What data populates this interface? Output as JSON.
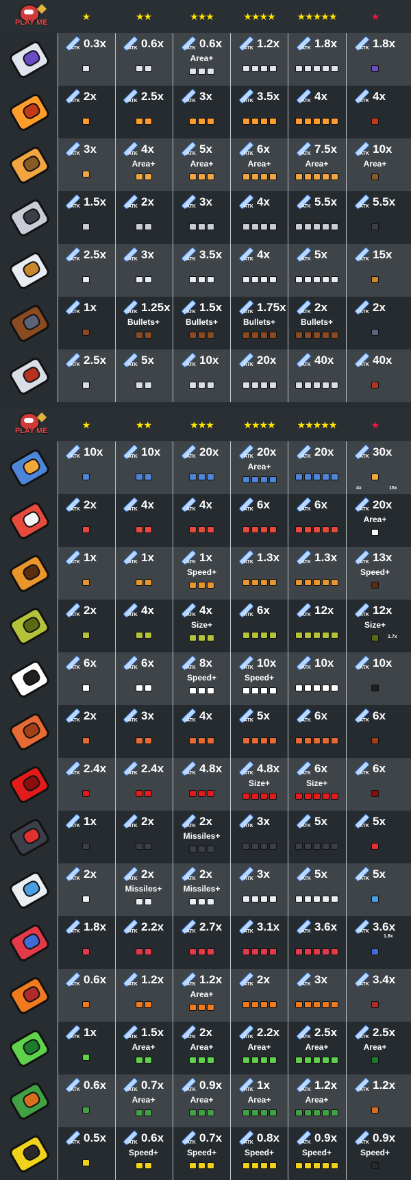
{
  "logo_text": "PLAY ME",
  "star_headers": [
    {
      "label": "★",
      "color": "yellow"
    },
    {
      "label": "★★",
      "color": "yellow"
    },
    {
      "label": "★★★",
      "color": "yellow"
    },
    {
      "label": "★★★★",
      "color": "yellow"
    },
    {
      "label": "★★★★★",
      "color": "yellow"
    },
    {
      "label": "★",
      "color": "red"
    }
  ],
  "atk_label": "ATK",
  "tables": [
    {
      "weapons": [
        {
          "icon": "blaster-gun-icon",
          "tiers": [
            {
              "m": "0.3x",
              "s": ""
            },
            {
              "m": "0.6x",
              "s": ""
            },
            {
              "m": "0.6x",
              "s": "Area+"
            },
            {
              "m": "1.2x",
              "s": ""
            },
            {
              "m": "1.8x",
              "s": ""
            },
            {
              "m": "1.8x",
              "s": ""
            }
          ]
        },
        {
          "icon": "flame-sword-icon",
          "tiers": [
            {
              "m": "2x",
              "s": ""
            },
            {
              "m": "2.5x",
              "s": ""
            },
            {
              "m": "3x",
              "s": ""
            },
            {
              "m": "3.5x",
              "s": ""
            },
            {
              "m": "4x",
              "s": ""
            },
            {
              "m": "4x",
              "s": ""
            }
          ]
        },
        {
          "icon": "guandao-spear-icon",
          "tiers": [
            {
              "m": "3x",
              "s": ""
            },
            {
              "m": "4x",
              "s": "Area+"
            },
            {
              "m": "5x",
              "s": "Area+"
            },
            {
              "m": "6x",
              "s": "Area+"
            },
            {
              "m": "7.5x",
              "s": "Area+"
            },
            {
              "m": "10x",
              "s": "Area+"
            }
          ]
        },
        {
          "icon": "kunai-icon",
          "tiers": [
            {
              "m": "1.5x",
              "s": ""
            },
            {
              "m": "2x",
              "s": ""
            },
            {
              "m": "3x",
              "s": ""
            },
            {
              "m": "4x",
              "s": ""
            },
            {
              "m": "5.5x",
              "s": ""
            },
            {
              "m": "5.5x",
              "s": ""
            }
          ]
        },
        {
          "icon": "katana-icon",
          "tiers": [
            {
              "m": "2.5x",
              "s": ""
            },
            {
              "m": "3x",
              "s": ""
            },
            {
              "m": "3.5x",
              "s": ""
            },
            {
              "m": "4x",
              "s": ""
            },
            {
              "m": "5x",
              "s": ""
            },
            {
              "m": "15x",
              "s": ""
            }
          ]
        },
        {
          "icon": "shotgun-icon",
          "tiers": [
            {
              "m": "1x",
              "s": ""
            },
            {
              "m": "1.25x",
              "s": "Bullets+"
            },
            {
              "m": "1.5x",
              "s": "Bullets+"
            },
            {
              "m": "1.75x",
              "s": "Bullets+"
            },
            {
              "m": "2x",
              "s": "Bullets+"
            },
            {
              "m": "2x",
              "s": ""
            }
          ]
        },
        {
          "icon": "revolver-icon",
          "tiers": [
            {
              "m": "2.5x",
              "s": ""
            },
            {
              "m": "5x",
              "s": ""
            },
            {
              "m": "10x",
              "s": ""
            },
            {
              "m": "20x",
              "s": ""
            },
            {
              "m": "40x",
              "s": ""
            },
            {
              "m": "40x",
              "s": ""
            }
          ]
        }
      ]
    },
    {
      "weapons": [
        {
          "icon": "drone-disc-icon",
          "tiers": [
            {
              "m": "10x",
              "s": ""
            },
            {
              "m": "10x",
              "s": ""
            },
            {
              "m": "20x",
              "s": ""
            },
            {
              "m": "20x",
              "s": "Area+"
            },
            {
              "m": "20x",
              "s": ""
            },
            {
              "m": "30x",
              "s": ""
            }
          ]
        },
        {
          "icon": "rocket-icon",
          "tiers": [
            {
              "m": "2x",
              "s": ""
            },
            {
              "m": "4x",
              "s": ""
            },
            {
              "m": "4x",
              "s": ""
            },
            {
              "m": "6x",
              "s": ""
            },
            {
              "m": "6x",
              "s": ""
            },
            {
              "m": "20x",
              "s": "Area+"
            }
          ]
        },
        {
          "icon": "drill-cone-icon",
          "tiers": [
            {
              "m": "1x",
              "s": ""
            },
            {
              "m": "1x",
              "s": ""
            },
            {
              "m": "1x",
              "s": "Speed+"
            },
            {
              "m": "1.3x",
              "s": ""
            },
            {
              "m": "1.3x",
              "s": ""
            },
            {
              "m": "13x",
              "s": "Speed+"
            }
          ]
        },
        {
          "icon": "durian-icon",
          "tiers": [
            {
              "m": "2x",
              "s": ""
            },
            {
              "m": "4x",
              "s": ""
            },
            {
              "m": "4x",
              "s": "Size+"
            },
            {
              "m": "6x",
              "s": ""
            },
            {
              "m": "12x",
              "s": ""
            },
            {
              "m": "12x",
              "s": "Size+"
            }
          ]
        },
        {
          "icon": "soccer-ball-icon",
          "tiers": [
            {
              "m": "6x",
              "s": ""
            },
            {
              "m": "6x",
              "s": ""
            },
            {
              "m": "8x",
              "s": "Speed+"
            },
            {
              "m": "10x",
              "s": "Speed+"
            },
            {
              "m": "10x",
              "s": ""
            },
            {
              "m": "10x",
              "s": ""
            }
          ]
        },
        {
          "icon": "brick-icon",
          "tiers": [
            {
              "m": "2x",
              "s": ""
            },
            {
              "m": "3x",
              "s": ""
            },
            {
              "m": "4x",
              "s": ""
            },
            {
              "m": "5x",
              "s": ""
            },
            {
              "m": "6x",
              "s": ""
            },
            {
              "m": "6x",
              "s": ""
            }
          ]
        },
        {
          "icon": "boomerang-icon",
          "tiers": [
            {
              "m": "2.4x",
              "s": ""
            },
            {
              "m": "2.4x",
              "s": ""
            },
            {
              "m": "4.8x",
              "s": ""
            },
            {
              "m": "4.8x",
              "s": "Size+"
            },
            {
              "m": "6x",
              "s": "Size+"
            },
            {
              "m": "6x",
              "s": ""
            }
          ]
        },
        {
          "icon": "missile-pod-icon",
          "tiers": [
            {
              "m": "1x",
              "s": ""
            },
            {
              "m": "2x",
              "s": ""
            },
            {
              "m": "2x",
              "s": "Missiles+"
            },
            {
              "m": "3x",
              "s": ""
            },
            {
              "m": "5x",
              "s": ""
            },
            {
              "m": "5x",
              "s": ""
            }
          ]
        },
        {
          "icon": "missile-launcher-icon",
          "tiers": [
            {
              "m": "2x",
              "s": ""
            },
            {
              "m": "2x",
              "s": "Missiles+"
            },
            {
              "m": "2x",
              "s": "Missiles+"
            },
            {
              "m": "3x",
              "s": ""
            },
            {
              "m": "5x",
              "s": ""
            },
            {
              "m": "5x",
              "s": ""
            }
          ]
        },
        {
          "icon": "tesla-coil-icon",
          "tiers": [
            {
              "m": "1.8x",
              "s": ""
            },
            {
              "m": "2.2x",
              "s": ""
            },
            {
              "m": "2.7x",
              "s": ""
            },
            {
              "m": "3.1x",
              "s": ""
            },
            {
              "m": "3.6x",
              "s": ""
            },
            {
              "m": "3.6x",
              "s": ""
            }
          ]
        },
        {
          "icon": "remote-detonator-icon",
          "tiers": [
            {
              "m": "0.6x",
              "s": ""
            },
            {
              "m": "1.2x",
              "s": ""
            },
            {
              "m": "1.2x",
              "s": "Area+"
            },
            {
              "m": "2x",
              "s": ""
            },
            {
              "m": "3x",
              "s": ""
            },
            {
              "m": "3.4x",
              "s": ""
            }
          ]
        },
        {
          "icon": "landmine-icon",
          "tiers": [
            {
              "m": "1x",
              "s": ""
            },
            {
              "m": "1.5x",
              "s": "Area+"
            },
            {
              "m": "2x",
              "s": "Area+"
            },
            {
              "m": "2.2x",
              "s": "Area+"
            },
            {
              "m": "2.5x",
              "s": "Area+"
            },
            {
              "m": "2.5x",
              "s": "Area+"
            }
          ]
        },
        {
          "icon": "molotov-bottle-icon",
          "tiers": [
            {
              "m": "0.6x",
              "s": ""
            },
            {
              "m": "0.7x",
              "s": "Area+"
            },
            {
              "m": "0.9x",
              "s": "Area+"
            },
            {
              "m": "1x",
              "s": "Area+"
            },
            {
              "m": "1.2x",
              "s": "Area+"
            },
            {
              "m": "1.2x",
              "s": ""
            }
          ]
        },
        {
          "icon": "guardian-shuriken-icon",
          "tiers": [
            {
              "m": "0.5x",
              "s": ""
            },
            {
              "m": "0.6x",
              "s": "Speed+"
            },
            {
              "m": "0.7x",
              "s": "Speed+"
            },
            {
              "m": "0.8x",
              "s": "Speed+"
            },
            {
              "m": "0.9x",
              "s": "Speed+"
            },
            {
              "m": "0.9x",
              "s": "Speed+"
            }
          ]
        }
      ]
    }
  ],
  "extra_labels": {
    "drone_evo_a": "4x",
    "drone_evo_b": "15x",
    "durian_evo": "1.7x",
    "tesla_evo": "1.8x"
  },
  "colors": {
    "background": "#282d31",
    "row_dark": "#262b2f",
    "row_light": "#3f4449",
    "star_yellow": "#ffe600",
    "star_red": "#e51c46"
  }
}
